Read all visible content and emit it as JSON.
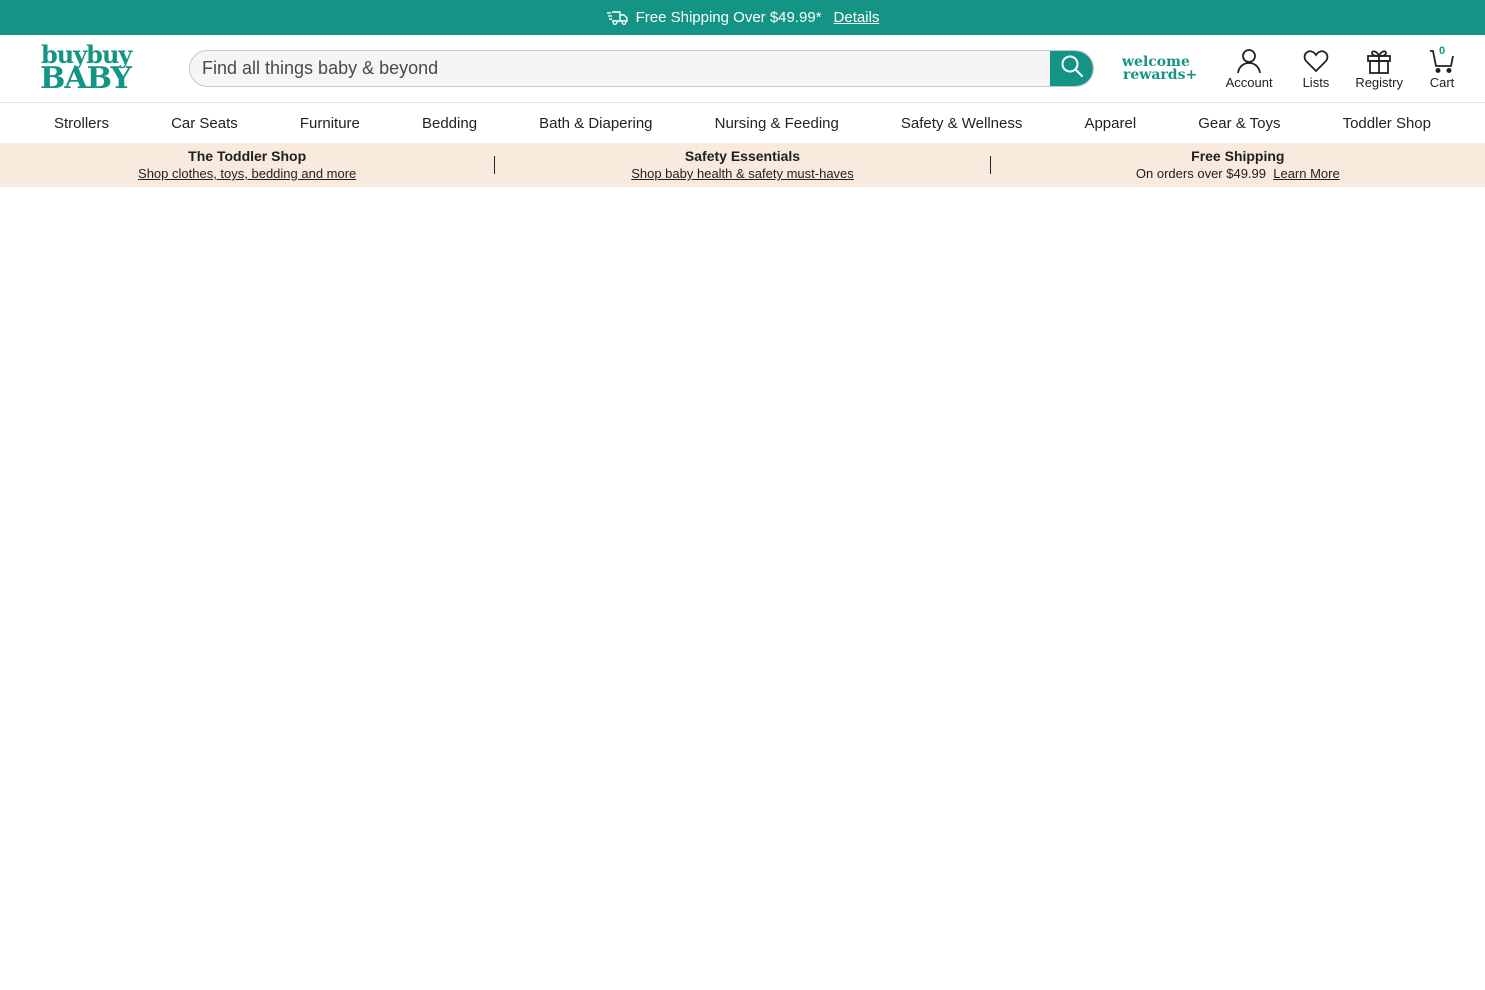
{
  "promo": {
    "text": "Free Shipping Over $49.99*",
    "details_label": "Details",
    "icon": "truck-icon"
  },
  "logo": {
    "line1": "buybuy",
    "line2": "BABY"
  },
  "search": {
    "placeholder": "Find all things baby & beyond",
    "value": ""
  },
  "rewards": {
    "line1": "welcome",
    "line2": "rewards+"
  },
  "header_actions": {
    "account_label": "Account",
    "lists_label": "Lists",
    "registry_label": "Registry",
    "cart_label": "Cart",
    "cart_count": "0"
  },
  "categories": [
    "Strollers",
    "Car Seats",
    "Furniture",
    "Bedding",
    "Bath & Diapering",
    "Nursing & Feeding",
    "Safety & Wellness",
    "Apparel",
    "Gear & Toys",
    "Toddler Shop"
  ],
  "info_strip": {
    "toddler": {
      "title": "The Toddler Shop",
      "link": "Shop clothes, toys, bedding and more"
    },
    "safety": {
      "title": "Safety Essentials",
      "link": "Shop baby health & safety must-haves"
    },
    "shipping": {
      "title": "Free Shipping",
      "text": "On orders over $49.99",
      "link": "Learn More"
    }
  },
  "colors": {
    "brand": "#149484",
    "info_bg": "#f8eadc"
  }
}
